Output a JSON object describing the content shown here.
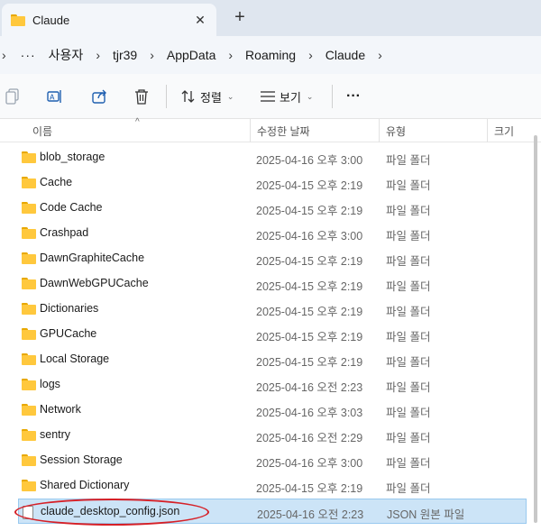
{
  "tab": {
    "title": "Claude",
    "close_glyph": "✕",
    "new_tab_glyph": "+"
  },
  "addressbar": {
    "back_glyph": "›",
    "more": "···",
    "crumbs": [
      "사용자",
      "tjr39",
      "AppData",
      "Roaming",
      "Claude"
    ],
    "separator": "›"
  },
  "commandbar": {
    "sort_label": "정렬",
    "view_label": "보기",
    "more_glyph": "···",
    "chevron": "⌄",
    "icons": [
      "copy-icon",
      "rename-icon",
      "share-icon",
      "delete-icon",
      "sort-icon",
      "view-icon"
    ]
  },
  "columns": {
    "name": "이름",
    "date": "수정한 날짜",
    "type": "유형",
    "size": "크기"
  },
  "files": [
    {
      "name": "blob_storage",
      "date": "2025-04-16 오후 3:00",
      "type": "파일 폴더",
      "kind": "folder"
    },
    {
      "name": "Cache",
      "date": "2025-04-15 오후 2:19",
      "type": "파일 폴더",
      "kind": "folder"
    },
    {
      "name": "Code Cache",
      "date": "2025-04-15 오후 2:19",
      "type": "파일 폴더",
      "kind": "folder"
    },
    {
      "name": "Crashpad",
      "date": "2025-04-16 오후 3:00",
      "type": "파일 폴더",
      "kind": "folder"
    },
    {
      "name": "DawnGraphiteCache",
      "date": "2025-04-15 오후 2:19",
      "type": "파일 폴더",
      "kind": "folder"
    },
    {
      "name": "DawnWebGPUCache",
      "date": "2025-04-15 오후 2:19",
      "type": "파일 폴더",
      "kind": "folder"
    },
    {
      "name": "Dictionaries",
      "date": "2025-04-15 오후 2:19",
      "type": "파일 폴더",
      "kind": "folder"
    },
    {
      "name": "GPUCache",
      "date": "2025-04-15 오후 2:19",
      "type": "파일 폴더",
      "kind": "folder"
    },
    {
      "name": "Local Storage",
      "date": "2025-04-15 오후 2:19",
      "type": "파일 폴더",
      "kind": "folder"
    },
    {
      "name": "logs",
      "date": "2025-04-16 오전 2:23",
      "type": "파일 폴더",
      "kind": "folder"
    },
    {
      "name": "Network",
      "date": "2025-04-16 오후 3:03",
      "type": "파일 폴더",
      "kind": "folder"
    },
    {
      "name": "sentry",
      "date": "2025-04-16 오전 2:29",
      "type": "파일 폴더",
      "kind": "folder"
    },
    {
      "name": "Session Storage",
      "date": "2025-04-16 오후 3:00",
      "type": "파일 폴더",
      "kind": "folder"
    },
    {
      "name": "Shared Dictionary",
      "date": "2025-04-15 오후 2:19",
      "type": "파일 폴더",
      "kind": "folder"
    },
    {
      "name": "claude_desktop_config.json",
      "date": "2025-04-16 오전 2:23",
      "type": "JSON 원본 파일",
      "kind": "file",
      "selected": true
    }
  ],
  "colors": {
    "accent_selection": "#cce4f7",
    "highlight": "#d62027",
    "folder": "#ffc83d"
  }
}
